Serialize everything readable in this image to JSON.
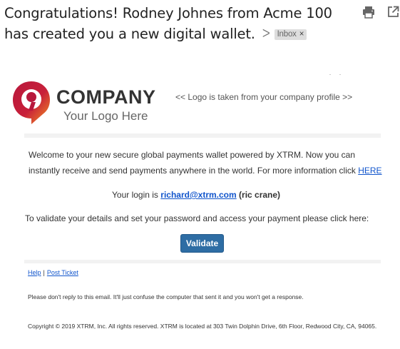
{
  "email": {
    "subject_line1": "Congratulations! Rodney Johnes from Acme 100",
    "subject_line2": "has created you a new digital wallet.",
    "label": "Inbox",
    "label_remove": "×",
    "important_icon": "importance-marker-icon",
    "print_icon": "print-icon",
    "external_icon": "open-in-new-window-icon"
  },
  "logo": {
    "company": "COMPANY",
    "tagline": "Your Logo Here",
    "note": "<< Logo is taken from your company profile >>",
    "brand_color": "#b8183c",
    "accent_color": "#f39321"
  },
  "body": {
    "welcome_text": "Welcome to your new secure global payments wallet powered by XTRM. Now you can instantly receive and send payments anywhere in the world. For more information click ",
    "here_link": "HERE",
    "login_prefix": "Your login is ",
    "login_email": "richard@xtrm.com",
    "login_name": " (ric crane)",
    "validate_instruction": "To validate your details and set your password and access your payment please click here:",
    "validate_button": "Validate",
    "button_color": "#2e6da4"
  },
  "footer": {
    "help_link": "Help",
    "separator": "|",
    "ticket_link": "Post Ticket",
    "no_reply_note": "Please don't reply to this email. It'll just confuse the computer that sent it and you won't get a response.",
    "copyright": "Copyright © 2019 XTRM, Inc. All rights reserved. XTRM is located at 303 Twin Dolphin Drive, 6th Floor, Redwood City, CA, 94065."
  }
}
